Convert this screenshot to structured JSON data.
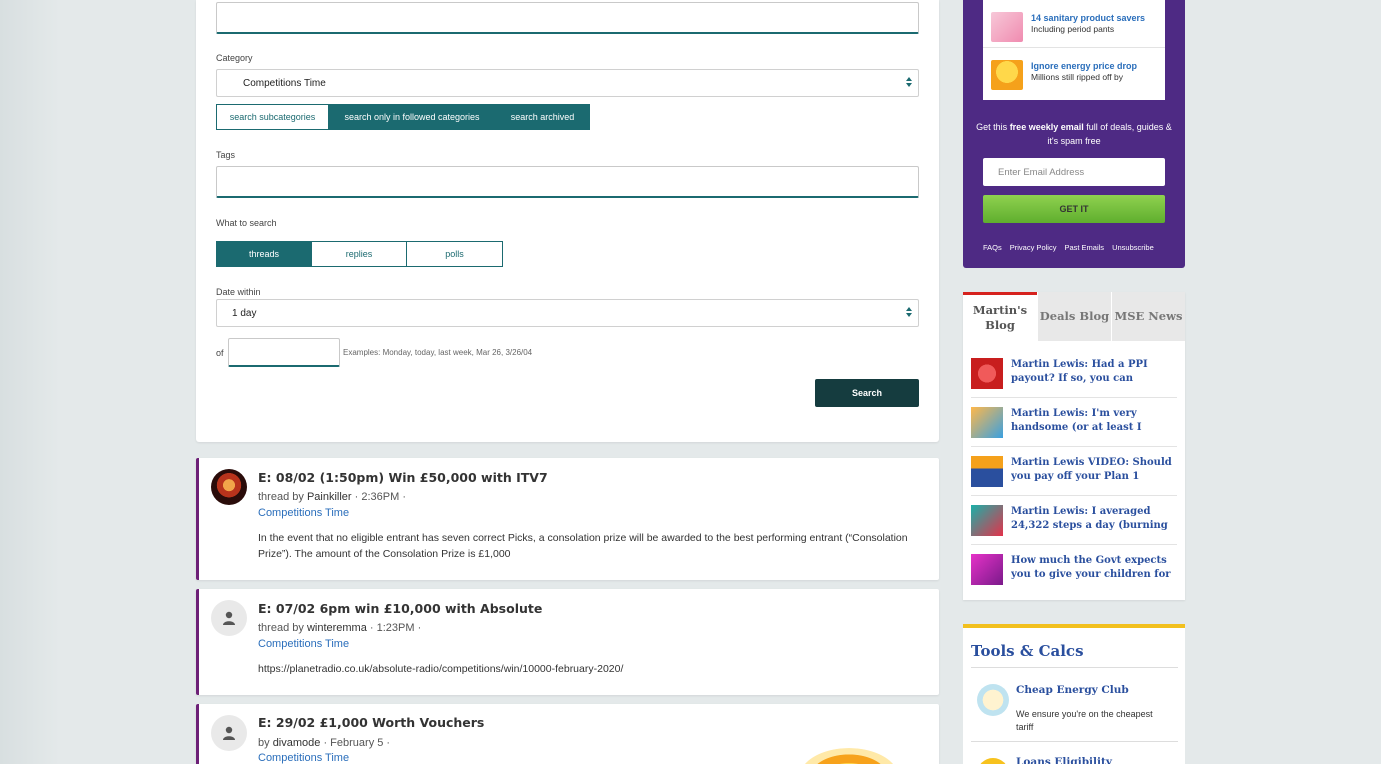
{
  "search_form": {
    "category_label": "Category",
    "category_value": "Competitions Time",
    "category_toggles": [
      "search subcategories",
      "search only in followed categories",
      "search archived"
    ],
    "tags_label": "Tags",
    "what_label": "What to search",
    "what_options": [
      "threads",
      "replies",
      "polls"
    ],
    "what_selected": "threads",
    "date_label": "Date within",
    "date_value": "1 day",
    "of_label": "of",
    "date_examples": "Examples: Monday, today, last week, Mar 26, 3/26/04",
    "search_button": "Search"
  },
  "threads": [
    {
      "title": "E: 08/02 (1:50pm) Win £50,000 with ITV7",
      "meta_prefix": "thread by",
      "user": "Painkiller",
      "time": "· 2:36PM ·",
      "category": "Competitions Time",
      "body": "In the event that no eligible entrant has seven correct Picks, a  consolation prize will be awarded to the best performing entrant (“Consolation Prize”). The amount of the Consolation Prize is £1,000",
      "avatar": "skull-avatar"
    },
    {
      "title": "E: 07/02 6pm win £10,000 with Absolute",
      "meta_prefix": "thread by",
      "user": "winteremma",
      "time": "· 1:23PM ·",
      "category": "Competitions Time",
      "body": "https://planetradio.co.uk/absolute-radio/competitions/win/10000-february-2020/",
      "avatar": "person-icon"
    },
    {
      "title": "E: 29/02 £1,000 Worth Vouchers",
      "meta_prefix": "by",
      "user": "divamode",
      "time": "· February 5 ·",
      "category": "Competitions Time",
      "body": "",
      "avatar": "person-icon"
    }
  ],
  "promo": {
    "items": [
      {
        "title": "14 sanitary product savers",
        "subtitle": "Including period pants"
      },
      {
        "title": "Ignore energy price drop",
        "subtitle": "Millions still ripped off by"
      }
    ],
    "text_pre": "Get this ",
    "text_bold": "free weekly email",
    "text_post": " full of deals, guides & it's spam free",
    "email_placeholder": "Enter Email Address",
    "cta": "GET IT",
    "links": [
      "FAQs",
      "Privacy Policy",
      "Past Emails",
      "Unsubscribe"
    ]
  },
  "blog": {
    "tabs": [
      "Martin's Blog",
      "Deals Blog",
      "MSE News"
    ],
    "active_tab": "Martin's Blog",
    "items": [
      "Martin Lewis: Had a PPI payout? If so, you can",
      "Martin Lewis: I'm very handsome (or at least I was)...",
      "Martin Lewis VIDEO: Should you pay off your Plan 1",
      "Martin Lewis: I averaged 24,322 steps a day (burning",
      "How much the Govt expects you to give your children for"
    ]
  },
  "tools": {
    "title": "Tools & Calcs",
    "items": [
      {
        "title": "Cheap Energy Club",
        "subtitle": "We ensure you're on the cheapest tariff"
      },
      {
        "title": "Loans Eligibility",
        "subtitle": ""
      }
    ]
  },
  "colors": {
    "teal": "#1b6a70",
    "dark_teal": "#153c3f",
    "purple": "#4e2a84",
    "thread_accent": "#6d2077",
    "link_blue": "#2a6ebb",
    "serif_blue": "#2a4f9e",
    "cta_green": "#7cc242",
    "tools_yellow": "#f2c01e"
  }
}
